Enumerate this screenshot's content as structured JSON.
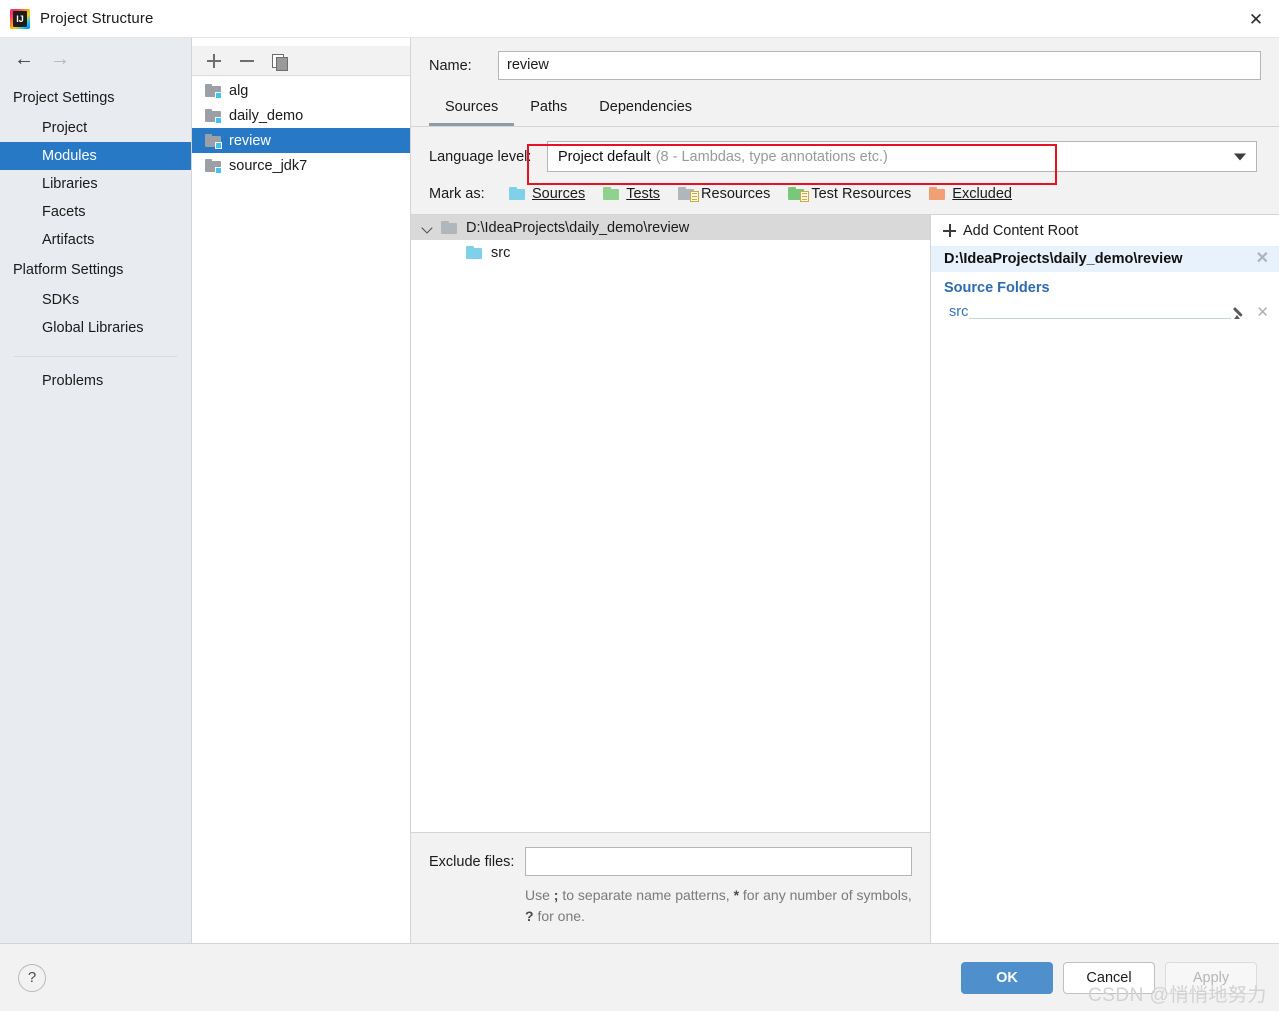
{
  "window": {
    "title": "Project Structure",
    "app_icon": "intellij-idea-logo",
    "close_label": "✕"
  },
  "sidebar": {
    "back_arrow": "←",
    "forward_arrow": "→",
    "groups": [
      {
        "label": "Project Settings",
        "items": [
          {
            "label": "Project",
            "selected": false
          },
          {
            "label": "Modules",
            "selected": true
          },
          {
            "label": "Libraries",
            "selected": false
          },
          {
            "label": "Facets",
            "selected": false
          },
          {
            "label": "Artifacts",
            "selected": false
          }
        ]
      },
      {
        "label": "Platform Settings",
        "items": [
          {
            "label": "SDKs",
            "selected": false
          },
          {
            "label": "Global Libraries",
            "selected": false
          }
        ]
      }
    ],
    "problems_label": "Problems"
  },
  "modules_panel": {
    "toolbar": {
      "add_label": "+",
      "remove_label": "−",
      "copy_label": "copy-icon"
    },
    "modules": [
      {
        "name": "alg",
        "selected": false
      },
      {
        "name": "daily_demo",
        "selected": false
      },
      {
        "name": "review",
        "selected": true
      },
      {
        "name": "source_jdk7",
        "selected": false
      }
    ]
  },
  "main": {
    "name_label": "Name:",
    "name_value": "review",
    "tabs": [
      {
        "label": "Sources",
        "active": true
      },
      {
        "label": "Paths",
        "active": false
      },
      {
        "label": "Dependencies",
        "active": false
      }
    ],
    "language_level": {
      "label": "Language level:",
      "value_main": "Project default",
      "value_sub": "(8 - Lambdas, type annotations etc.)",
      "highlight_color": "#e81123"
    },
    "mark_as": {
      "label": "Mark as:",
      "options": [
        {
          "label": "Sources",
          "mnemonic": "S",
          "color": "#7fd1ea",
          "icon": "folder-sources-icon"
        },
        {
          "label": "Tests",
          "mnemonic": "T",
          "color": "#8fd18f",
          "icon": "folder-tests-icon"
        },
        {
          "label": "Resources",
          "mnemonic": "R",
          "color": "#b1b6ba",
          "icon": "folder-resources-icon"
        },
        {
          "label": "Test Resources",
          "mnemonic": "",
          "color": "#79c879",
          "icon": "folder-test-resources-icon"
        },
        {
          "label": "Excluded",
          "mnemonic": "E",
          "color": "#f0a073",
          "icon": "folder-excluded-icon"
        }
      ]
    },
    "tree": [
      {
        "label": "D:\\IdeaProjects\\daily_demo\\review",
        "level": 0,
        "icon": "folder-gray-icon",
        "expanded": true,
        "selected": true
      },
      {
        "label": "src",
        "level": 1,
        "icon": "folder-sources-icon",
        "expanded": false,
        "selected": false
      }
    ],
    "exclude": {
      "label": "Exclude files:",
      "value": "",
      "hint_prefix": "Use ",
      "hint_semicolon": ";",
      "hint_mid1": " to separate name patterns, ",
      "hint_star": "*",
      "hint_mid2": " for any number of symbols, ",
      "hint_question": "?",
      "hint_suffix": " for one."
    }
  },
  "roots_panel": {
    "add_content_root": "Add Content Root",
    "content_root_path": "D:\\IdeaProjects\\daily_demo\\review",
    "content_root_remove": "✕",
    "source_folders_title": "Source Folders",
    "source_folders": [
      {
        "name": "src",
        "edit_icon": "pencil-icon",
        "remove_label": "✕"
      }
    ]
  },
  "bottom": {
    "help_label": "?",
    "buttons": [
      {
        "label": "OK",
        "style": "primary"
      },
      {
        "label": "Cancel",
        "style": "normal"
      },
      {
        "label": "Apply",
        "style": "disabled"
      }
    ]
  },
  "watermark": "CSDN @悄悄地努力"
}
